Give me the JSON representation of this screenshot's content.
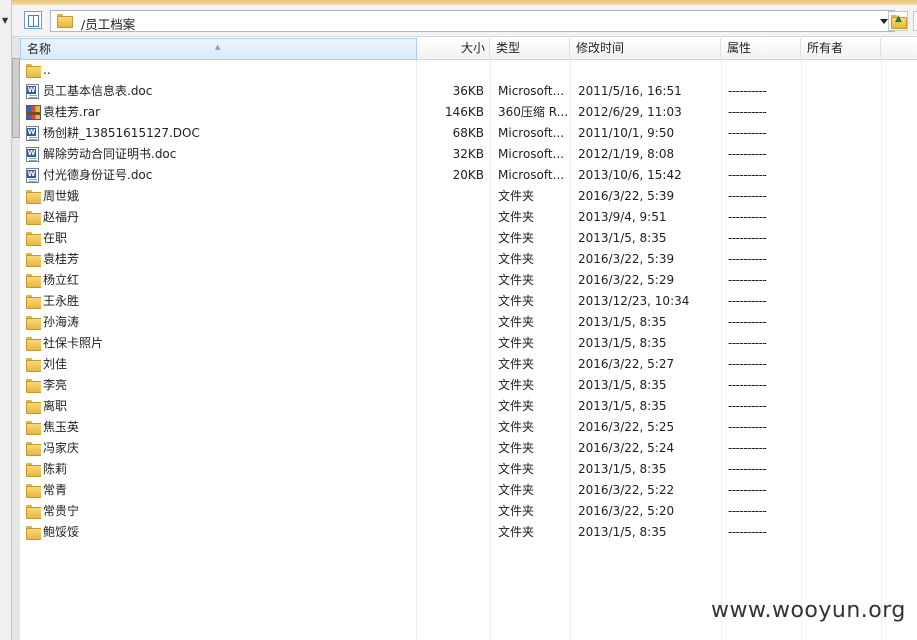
{
  "path_bar": {
    "path": "/员工档案"
  },
  "columns": {
    "name": "名称",
    "size": "大小",
    "type": "类型",
    "mtime": "修改时间",
    "attr": "属性",
    "owner": "所有者"
  },
  "files": [
    {
      "icon": "folder-icon",
      "name": "..",
      "size": "",
      "type": "",
      "mtime": "",
      "attr": ""
    },
    {
      "icon": "doc-icon",
      "name": "员工基本信息表.doc",
      "size": "36KB",
      "type": "Microsoft...",
      "mtime": "2011/5/16, 16:51",
      "attr": "----------"
    },
    {
      "icon": "rar-icon",
      "name": "袁桂芳.rar",
      "size": "146KB",
      "type": "360压缩 R...",
      "mtime": "2012/6/29, 11:03",
      "attr": "----------"
    },
    {
      "icon": "doc-icon",
      "name": "杨创耕_13851615127.DOC",
      "size": "68KB",
      "type": "Microsoft...",
      "mtime": "2011/10/1, 9:50",
      "attr": "----------"
    },
    {
      "icon": "doc-icon",
      "name": "解除劳动合同证明书.doc",
      "size": "32KB",
      "type": "Microsoft...",
      "mtime": "2012/1/19, 8:08",
      "attr": "----------"
    },
    {
      "icon": "doc-icon",
      "name": "付光德身份证号.doc",
      "size": "20KB",
      "type": "Microsoft...",
      "mtime": "2013/10/6, 15:42",
      "attr": "----------"
    },
    {
      "icon": "folder-icon",
      "name": "周世娥",
      "size": "",
      "type": "文件夹",
      "mtime": "2016/3/22, 5:39",
      "attr": "----------"
    },
    {
      "icon": "folder-icon",
      "name": "赵福丹",
      "size": "",
      "type": "文件夹",
      "mtime": "2013/9/4, 9:51",
      "attr": "----------"
    },
    {
      "icon": "folder-icon",
      "name": "在职",
      "size": "",
      "type": "文件夹",
      "mtime": "2013/1/5, 8:35",
      "attr": "----------"
    },
    {
      "icon": "folder-icon",
      "name": "袁桂芳",
      "size": "",
      "type": "文件夹",
      "mtime": "2016/3/22, 5:39",
      "attr": "----------"
    },
    {
      "icon": "folder-icon",
      "name": "杨立红",
      "size": "",
      "type": "文件夹",
      "mtime": "2016/3/22, 5:29",
      "attr": "----------"
    },
    {
      "icon": "folder-icon",
      "name": "王永胜",
      "size": "",
      "type": "文件夹",
      "mtime": "2013/12/23, 10:34",
      "attr": "----------"
    },
    {
      "icon": "folder-icon",
      "name": "孙海涛",
      "size": "",
      "type": "文件夹",
      "mtime": "2013/1/5, 8:35",
      "attr": "----------"
    },
    {
      "icon": "folder-icon",
      "name": "社保卡照片",
      "size": "",
      "type": "文件夹",
      "mtime": "2013/1/5, 8:35",
      "attr": "----------"
    },
    {
      "icon": "folder-icon",
      "name": "刘佳",
      "size": "",
      "type": "文件夹",
      "mtime": "2016/3/22, 5:27",
      "attr": "----------"
    },
    {
      "icon": "folder-icon",
      "name": "李亮",
      "size": "",
      "type": "文件夹",
      "mtime": "2013/1/5, 8:35",
      "attr": "----------"
    },
    {
      "icon": "folder-icon",
      "name": "离职",
      "size": "",
      "type": "文件夹",
      "mtime": "2013/1/5, 8:35",
      "attr": "----------"
    },
    {
      "icon": "folder-icon",
      "name": "焦玉英",
      "size": "",
      "type": "文件夹",
      "mtime": "2016/3/22, 5:25",
      "attr": "----------"
    },
    {
      "icon": "folder-icon",
      "name": "冯家庆",
      "size": "",
      "type": "文件夹",
      "mtime": "2016/3/22, 5:24",
      "attr": "----------"
    },
    {
      "icon": "folder-icon",
      "name": "陈莉",
      "size": "",
      "type": "文件夹",
      "mtime": "2013/1/5, 8:35",
      "attr": "----------"
    },
    {
      "icon": "folder-icon",
      "name": "常青",
      "size": "",
      "type": "文件夹",
      "mtime": "2016/3/22, 5:22",
      "attr": "----------"
    },
    {
      "icon": "folder-icon",
      "name": "常贵宁",
      "size": "",
      "type": "文件夹",
      "mtime": "2016/3/22, 5:20",
      "attr": "----------"
    },
    {
      "icon": "folder-icon",
      "name": "鲍馁馁",
      "size": "",
      "type": "文件夹",
      "mtime": "2013/1/5, 8:35",
      "attr": "----------"
    }
  ],
  "watermark": "www.wooyun.org",
  "colors": {
    "header_selected": "#d9ebfb",
    "folder": "#f8d97a",
    "path_border": "#a9b8cc"
  }
}
